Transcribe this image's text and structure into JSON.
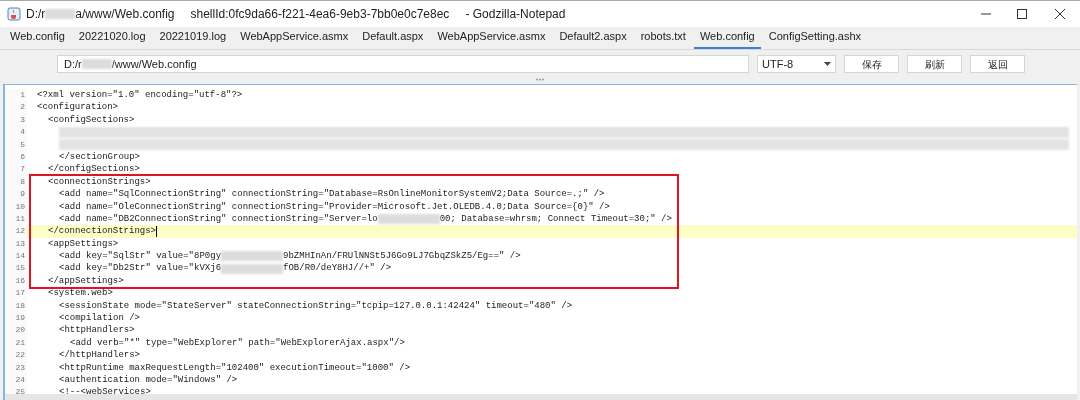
{
  "window": {
    "title": [
      {
        "kind": "text",
        "text": "D:/r"
      },
      {
        "kind": "redacted"
      },
      {
        "kind": "text",
        "text": "a/www/Web.config"
      }
    ],
    "shell_id": "shellId:0fc9da66-f221-4ea6-9eb3-7bb0e0c7e8ec",
    "app": "- Godzilla-Notepad"
  },
  "tabs": [
    {
      "label": "Web.config",
      "selected": false
    },
    {
      "label": "20221020.log",
      "selected": false
    },
    {
      "label": "20221019.log",
      "selected": false
    },
    {
      "label": "WebAppService.asmx",
      "selected": false
    },
    {
      "label": "Default.aspx",
      "selected": false
    },
    {
      "label": "WebAppService.asmx",
      "selected": false
    },
    {
      "label": "Default2.aspx",
      "selected": false
    },
    {
      "label": "robots.txt",
      "selected": false
    },
    {
      "label": "Web.config",
      "selected": true
    },
    {
      "label": "ConfigSetting.ashx",
      "selected": false
    }
  ],
  "toolbar": {
    "path": [
      {
        "kind": "text",
        "text": "D:/r"
      },
      {
        "kind": "redacted"
      },
      {
        "kind": "text",
        "text": "/www/Web.config"
      }
    ],
    "encoding": "UTF-8",
    "buttons": [
      "保存",
      "刷新",
      "返回"
    ]
  },
  "editor": {
    "lines": [
      {
        "number": "1",
        "current": false,
        "boxed": false,
        "parts": [
          {
            "kind": "text",
            "text": "<?xml version=\"1.0\" encoding=\"utf-8\"?>"
          }
        ]
      },
      {
        "number": "2",
        "current": false,
        "boxed": false,
        "parts": [
          {
            "kind": "text",
            "text": "<configuration>"
          }
        ],
        "children": [
          {
            "number": "3",
            "current": false,
            "boxed": false,
            "parts": [
              {
                "kind": "text",
                "text": "<configSections>"
              }
            ],
            "children": [
              {
                "number": "4",
                "current": false,
                "boxed": false,
                "parts": [
                  {
                    "kind": "redacted_line"
                  }
                ]
              },
              {
                "number": "5",
                "current": false,
                "boxed": false,
                "parts": [
                  {
                    "kind": "redacted_line"
                  }
                ]
              },
              {
                "number": "6",
                "current": false,
                "boxed": false,
                "parts": [
                  {
                    "kind": "text",
                    "text": "</sectionGroup>"
                  }
                ]
              }
            ]
          },
          {
            "number": "7",
            "current": false,
            "boxed": false,
            "parts": [
              {
                "kind": "text",
                "text": "</configSections>"
              }
            ]
          },
          {
            "number": "8",
            "current": false,
            "boxed": true,
            "parts": [
              {
                "kind": "text",
                "text": "<connectionStrings>"
              }
            ],
            "children": [
              {
                "number": "9",
                "current": false,
                "boxed": true,
                "parts": [
                  {
                    "kind": "text",
                    "text": "<add name=\"SqlConnectionString\" connectionString=\"Database=RsOnlineMonitorSystemV2;Data Source=.;\" />"
                  }
                ]
              },
              {
                "number": "10",
                "current": false,
                "boxed": true,
                "parts": [
                  {
                    "kind": "text",
                    "text": "<add name=\"OleConnectionString\" connectionString=\"Provider=Microsoft.Jet.OLEDB.4.0;Data Source={0}\" />"
                  }
                ]
              },
              {
                "number": "11",
                "current": false,
                "boxed": true,
                "parts": [
                  {
                    "kind": "text",
                    "text": "<add name=\"DB2ConnectionString\" connectionString=\"Server=lo"
                  },
                  {
                    "kind": "redacted"
                  },
                  {
                    "kind": "text",
                    "text": "00; Database=whrsm; Connect Timeout=30;\" />"
                  }
                ]
              }
            ]
          },
          {
            "number": "12",
            "current": true,
            "boxed": true,
            "parts": [
              {
                "kind": "text",
                "text": "</connectionStrings>"
              }
            ]
          },
          {
            "number": "13",
            "current": false,
            "boxed": true,
            "parts": [
              {
                "kind": "text",
                "text": "<appSettings>"
              }
            ],
            "children": [
              {
                "number": "14",
                "current": false,
                "boxed": true,
                "parts": [
                  {
                    "kind": "text",
                    "text": "<add key=\"SqlStr\" value=\"8P0gy"
                  },
                  {
                    "kind": "redacted"
                  },
                  {
                    "kind": "text",
                    "text": "9bZMHInAn/FRUlNNSt5J6Go9LJ7GbqZSkZ5/Eg==\" />"
                  }
                ]
              },
              {
                "number": "15",
                "current": false,
                "boxed": true,
                "parts": [
                  {
                    "kind": "text",
                    "text": "<add key=\"Db2Str\" value=\"kVXj6"
                  },
                  {
                    "kind": "redacted"
                  },
                  {
                    "kind": "text",
                    "text": "fOB/R0/deY8HJ//+\" />"
                  }
                ]
              }
            ]
          },
          {
            "number": "16",
            "current": false,
            "boxed": true,
            "parts": [
              {
                "kind": "text",
                "text": "</appSettings>"
              }
            ]
          },
          {
            "number": "17",
            "current": false,
            "boxed": false,
            "parts": [
              {
                "kind": "text",
                "text": "<system.web>"
              }
            ],
            "children": [
              {
                "number": "18",
                "current": false,
                "boxed": false,
                "parts": [
                  {
                    "kind": "text",
                    "text": "<sessionState mode=\"StateServer\" stateConnectionString=\"tcpip=127.0.0.1:42424\" timeout=\"480\" />"
                  }
                ]
              },
              {
                "number": "19",
                "current": false,
                "boxed": false,
                "parts": [
                  {
                    "kind": "text",
                    "text": "<compilation />"
                  }
                ]
              },
              {
                "number": "20",
                "current": false,
                "boxed": false,
                "parts": [
                  {
                    "kind": "text",
                    "text": "<httpHandlers>"
                  }
                ],
                "children": [
                  {
                    "number": "21",
                    "current": false,
                    "boxed": false,
                    "parts": [
                      {
                        "kind": "text",
                        "text": "<add verb=\"*\" type=\"WebExplorer\" path=\"WebExplorerAjax.aspx\"/>"
                      }
                    ]
                  }
                ]
              },
              {
                "number": "22",
                "current": false,
                "boxed": false,
                "parts": [
                  {
                    "kind": "text",
                    "text": "</httpHandlers>"
                  }
                ]
              },
              {
                "number": "23",
                "current": false,
                "boxed": false,
                "parts": [
                  {
                    "kind": "text",
                    "text": "<httpRuntime maxRequestLength=\"102400\" executionTimeout=\"1000\" />"
                  }
                ]
              },
              {
                "number": "24",
                "current": false,
                "boxed": false,
                "parts": [
                  {
                    "kind": "text",
                    "text": "<authentication mode=\"Windows\" />"
                  }
                ]
              },
              {
                "number": "25",
                "current": false,
                "boxed": false,
                "parts": [
                  {
                    "kind": "text",
                    "text": "<!--<webServices>"
                  }
                ]
              }
            ]
          }
        ]
      }
    ]
  }
}
